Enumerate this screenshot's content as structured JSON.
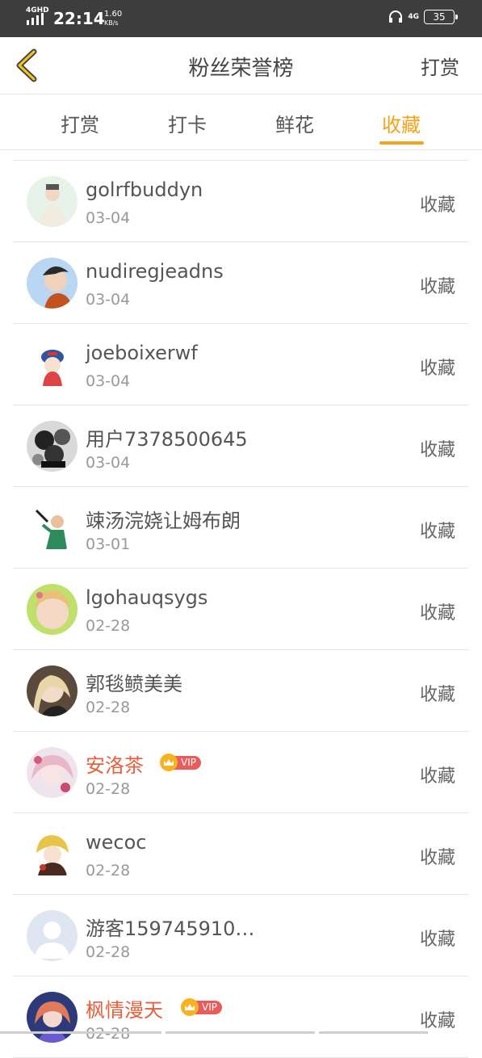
{
  "status_bar": {
    "network": "4GHD",
    "time": "22:14",
    "speed_value": "1.60",
    "speed_unit": "KB/s",
    "right_network": "4G",
    "battery": "35"
  },
  "header": {
    "title": "粉丝荣誉榜",
    "action_label": "打赏"
  },
  "tabs": [
    {
      "label": "打赏"
    },
    {
      "label": "打卡"
    },
    {
      "label": "鲜花"
    },
    {
      "label": "收藏",
      "active": true
    }
  ],
  "vip_label": "VIP",
  "list": [
    {
      "name": "golrfbuddyn",
      "date": "03-04",
      "action": "收藏",
      "vip": false
    },
    {
      "name": "nudiregjeadns",
      "date": "03-04",
      "action": "收藏",
      "vip": false
    },
    {
      "name": "joeboixerwf",
      "date": "03-04",
      "action": "收藏",
      "vip": false
    },
    {
      "name": "用户7378500645",
      "date": "03-04",
      "action": "收藏",
      "vip": false
    },
    {
      "name": "竦汤浣娆让姆布朗",
      "date": "03-01",
      "action": "收藏",
      "vip": false
    },
    {
      "name": "lgohauqsygs",
      "date": "02-28",
      "action": "收藏",
      "vip": false
    },
    {
      "name": "郭毯鲼美美",
      "date": "02-28",
      "action": "收藏",
      "vip": false
    },
    {
      "name": "安洛茶",
      "date": "02-28",
      "action": "收藏",
      "vip": true
    },
    {
      "name": "wecoc",
      "date": "02-28",
      "action": "收藏",
      "vip": false
    },
    {
      "name": "游客159745910…",
      "date": "02-28",
      "action": "收藏",
      "vip": false
    },
    {
      "name": "枫情漫天",
      "date": "02-28",
      "action": "收藏",
      "vip": true
    }
  ],
  "colors": {
    "accent": "#f3a31b",
    "vip_name": "#e4603f",
    "vip_tag": "#e85c5c",
    "status_bar": "#3d3d3d"
  }
}
